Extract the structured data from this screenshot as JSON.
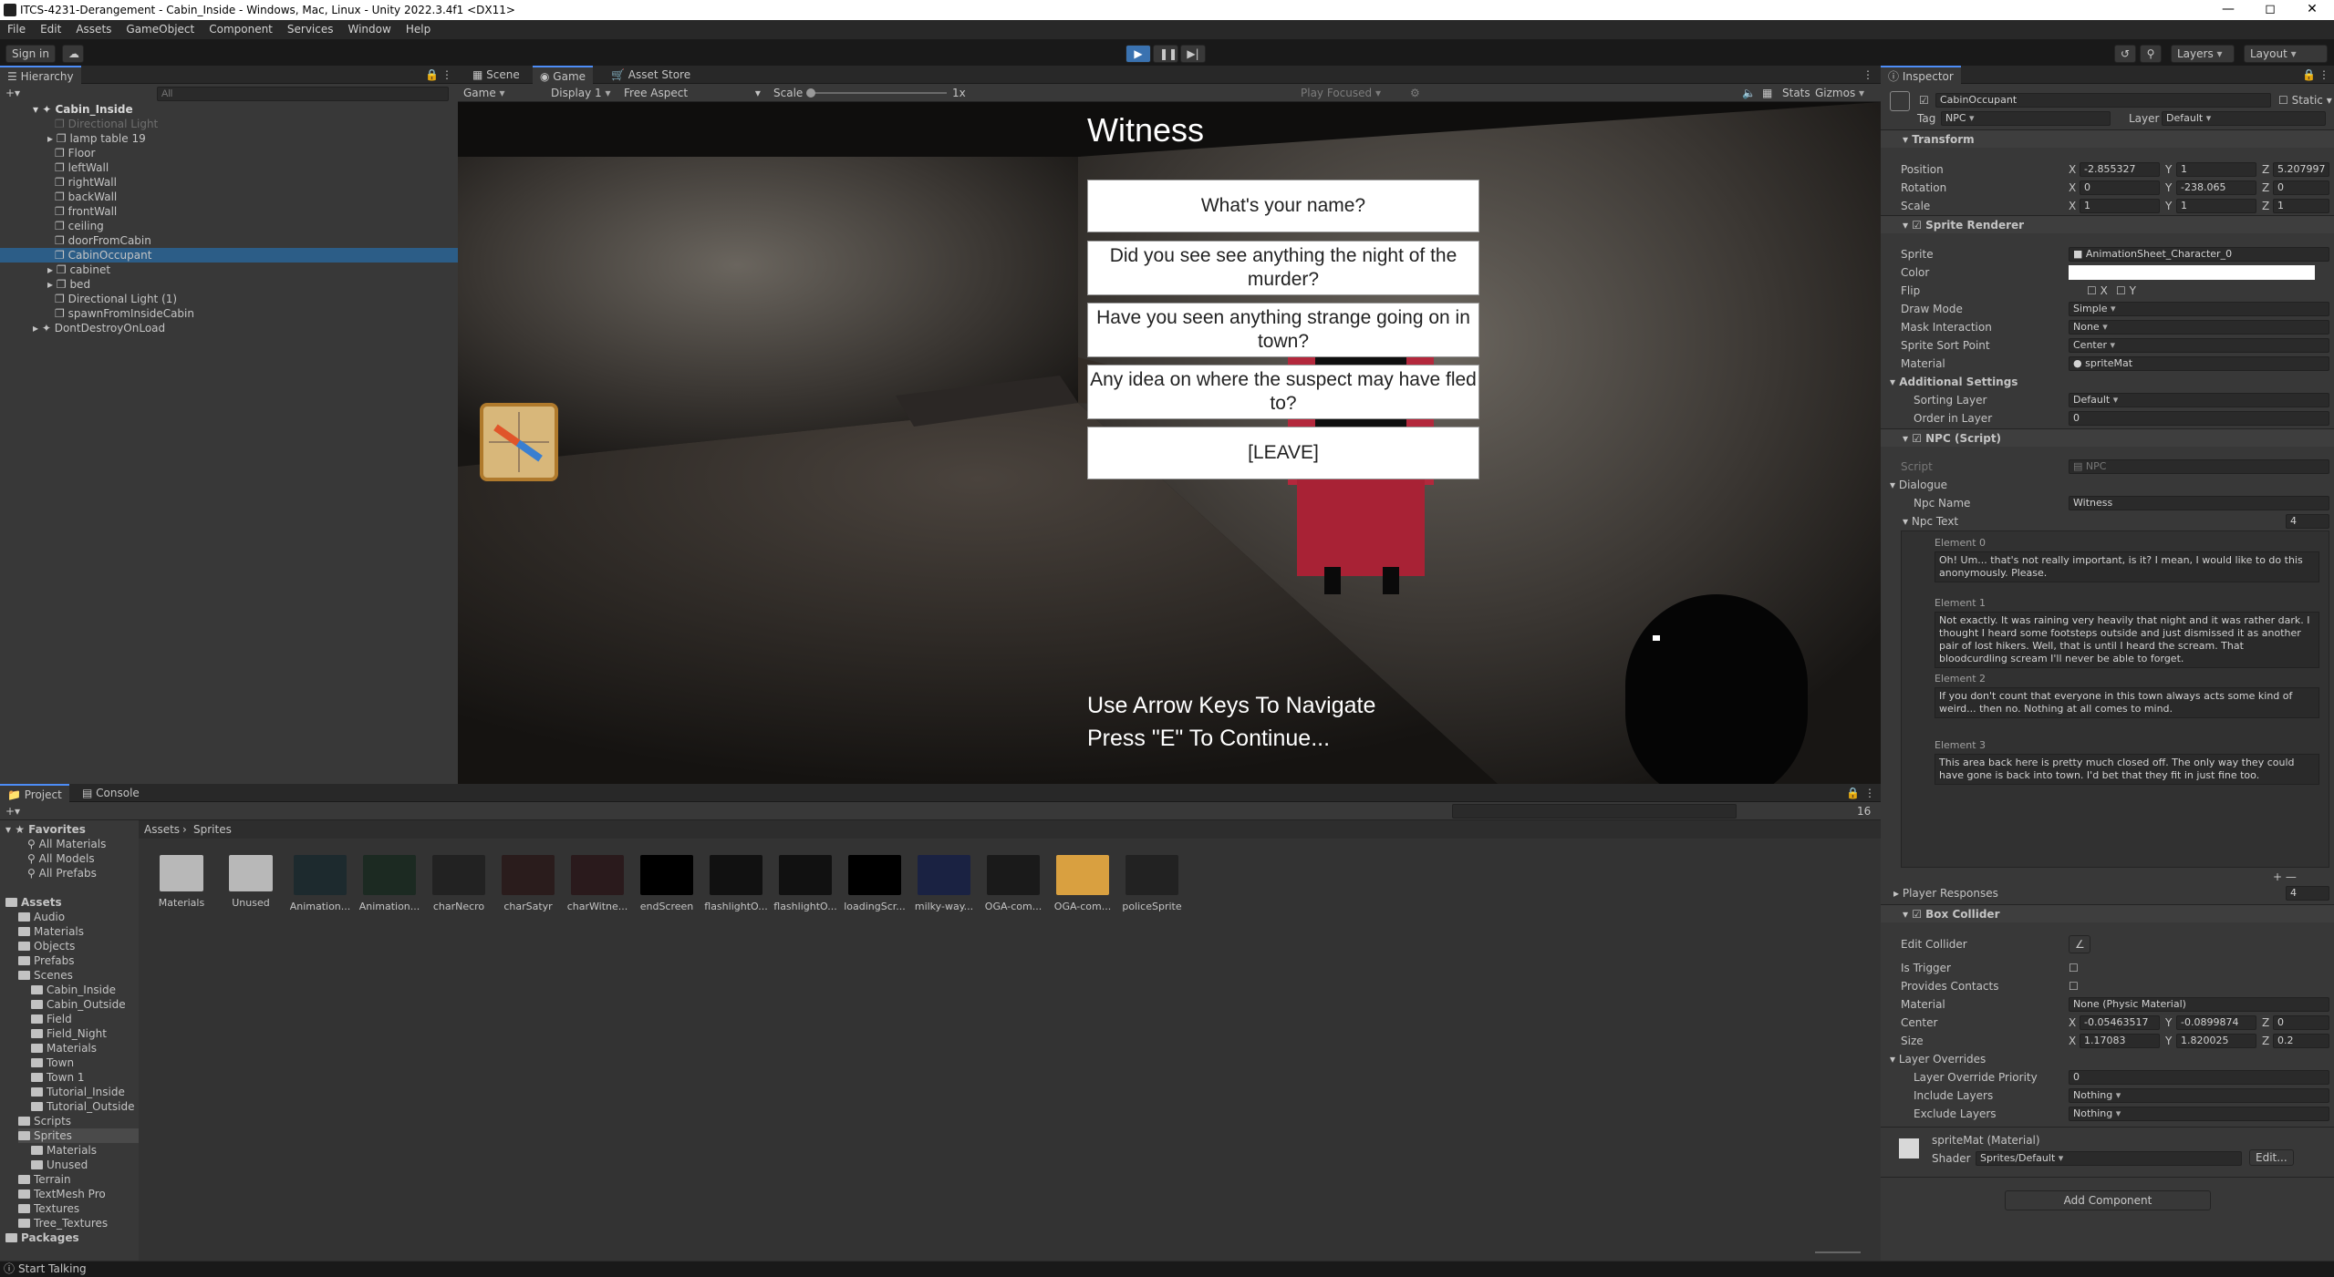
{
  "window": {
    "title": "ITCS-4231-Derangement - Cabin_Inside - Windows, Mac, Linux - Unity 2022.3.4f1 <DX11>"
  },
  "menu": [
    "File",
    "Edit",
    "Assets",
    "GameObject",
    "Component",
    "Services",
    "Window",
    "Help"
  ],
  "toolbar": {
    "sign_in": "Sign in",
    "layers": "Layers",
    "layout": "Layout"
  },
  "hierarchy": {
    "tab": "Hierarchy",
    "search_placeholder": "All",
    "scene": "Cabin_Inside",
    "items": [
      "Directional Light",
      "lamp table 19",
      "Floor",
      "leftWall",
      "rightWall",
      "backWall",
      "frontWall",
      "ceiling",
      "doorFromCabin",
      "CabinOccupant",
      "cabinet",
      "bed",
      "Directional Light (1)",
      "spawnFromInsideCabin"
    ],
    "dont_destroy": "DontDestroyOnLoad"
  },
  "game_view": {
    "tabs": [
      "Scene",
      "Game",
      "Asset Store"
    ],
    "display_mode": "Game",
    "display": "Display 1",
    "aspect": "Free Aspect",
    "scale_label": "Scale",
    "scale_value": "1x",
    "play_focused": "Play Focused",
    "stats": "Stats",
    "gizmos": "Gizmos"
  },
  "dialogue": {
    "npc_title": "Witness",
    "options": [
      "What's your name?",
      "Did you see see anything the night of the murder?",
      "Have you seen anything strange going on in town?",
      "Any idea on where the suspect may have fled to?",
      "[LEAVE]"
    ],
    "hint_line1": "Use Arrow Keys To Navigate",
    "hint_line2": "Press \"E\" To Continue..."
  },
  "project": {
    "tabs": [
      "Project",
      "Console"
    ],
    "breadcrumb": [
      "Assets",
      "Sprites"
    ],
    "favorites_label": "Favorites",
    "favorites": [
      "All Materials",
      "All Models",
      "All Prefabs"
    ],
    "tree": [
      {
        "label": "Assets",
        "depth": 0,
        "bold": true
      },
      {
        "label": "Audio",
        "depth": 1
      },
      {
        "label": "Materials",
        "depth": 1
      },
      {
        "label": "Objects",
        "depth": 1
      },
      {
        "label": "Prefabs",
        "depth": 1
      },
      {
        "label": "Scenes",
        "depth": 1
      },
      {
        "label": "Cabin_Inside",
        "depth": 2
      },
      {
        "label": "Cabin_Outside",
        "depth": 2
      },
      {
        "label": "Field",
        "depth": 2
      },
      {
        "label": "Field_Night",
        "depth": 2
      },
      {
        "label": "Materials",
        "depth": 2
      },
      {
        "label": "Town",
        "depth": 2
      },
      {
        "label": "Town 1",
        "depth": 2
      },
      {
        "label": "Tutorial_Inside",
        "depth": 2
      },
      {
        "label": "Tutorial_Outside",
        "depth": 2
      },
      {
        "label": "Scripts",
        "depth": 1
      },
      {
        "label": "Sprites",
        "depth": 1
      },
      {
        "label": "Materials",
        "depth": 2
      },
      {
        "label": "Unused",
        "depth": 2
      },
      {
        "label": "Terrain",
        "depth": 1
      },
      {
        "label": "TextMesh Pro",
        "depth": 1
      },
      {
        "label": "Textures",
        "depth": 1
      },
      {
        "label": "Tree_Textures",
        "depth": 1
      },
      {
        "label": "Packages",
        "depth": 0,
        "bold": true
      }
    ],
    "assets": [
      "Materials",
      "Unused",
      "Animation...",
      "Animation...",
      "charNecro",
      "charSatyr",
      "charWitne...",
      "endScreen",
      "flashlightO...",
      "flashlightO...",
      "loadingScr...",
      "milky-way...",
      "OGA-com...",
      "OGA-com...",
      "policeSprite"
    ],
    "count": "16"
  },
  "inspector": {
    "tab": "Inspector",
    "object_name": "CabinOccupant",
    "static_label": "Static",
    "tag_label": "Tag",
    "tag_value": "NPC",
    "layer_label": "Layer",
    "layer_value": "Default",
    "transform": {
      "title": "Transform",
      "position": {
        "label": "Position",
        "x": "-2.855327",
        "y": "1",
        "z": "5.207997"
      },
      "rotation": {
        "label": "Rotation",
        "x": "0",
        "y": "-238.065",
        "z": "0"
      },
      "scale": {
        "label": "Scale",
        "x": "1",
        "y": "1",
        "z": "1"
      }
    },
    "sprite_renderer": {
      "title": "Sprite Renderer",
      "sprite_label": "Sprite",
      "sprite_value": "AnimationSheet_Character_0",
      "color_label": "Color",
      "flip_label": "Flip",
      "flip_x": "X",
      "flip_y": "Y",
      "draw_mode_label": "Draw Mode",
      "draw_mode_value": "Simple",
      "mask_label": "Mask Interaction",
      "mask_value": "None",
      "sort_point_label": "Sprite Sort Point",
      "sort_point_value": "Center",
      "material_label": "Material",
      "material_value": "spriteMat",
      "additional_label": "Additional Settings",
      "sorting_layer_label": "Sorting Layer",
      "sorting_layer_value": "Default",
      "order_label": "Order in Layer",
      "order_value": "0"
    },
    "npc_script": {
      "title": "NPC (Script)",
      "script_label": "Script",
      "script_value": "NPC",
      "dialogue_label": "Dialogue",
      "npc_name_label": "Npc Name",
      "npc_name_value": "Witness",
      "npc_text_label": "Npc Text",
      "npc_text_count": "4",
      "elements": [
        {
          "label": "Element 0",
          "text": "Oh! Um... that's not really important, is it? I mean, I would like to do this anonymously. Please."
        },
        {
          "label": "Element 1",
          "text": "Not exactly. It was raining very heavily that night and it was rather dark. I thought I heard some footsteps outside and just dismissed it as another pair of lost hikers. Well, that is until I heard the scream. That bloodcurdling scream I'll never be able to forget."
        },
        {
          "label": "Element 2",
          "text": "If you don't count that everyone in this town always acts some kind of weird... then no. Nothing at all comes to mind."
        },
        {
          "label": "Element 3",
          "text": "This area back here is pretty much closed off. The only way they could have gone is back into town. I'd bet that they fit in just fine too."
        }
      ],
      "player_responses_label": "Player Responses",
      "player_responses_count": "4"
    },
    "box_collider": {
      "title": "Box Collider",
      "edit_label": "Edit Collider",
      "trigger_label": "Is Trigger",
      "contacts_label": "Provides Contacts",
      "material_label": "Material",
      "material_value": "None (Physic Material)",
      "center": {
        "label": "Center",
        "x": "-0.05463517",
        "y": "-0.0899874",
        "z": "0"
      },
      "size": {
        "label": "Size",
        "x": "1.17083",
        "y": "1.820025",
        "z": "0.2"
      },
      "overrides_label": "Layer Overrides",
      "priority_label": "Layer Override Priority",
      "priority_value": "0",
      "include_label": "Include Layers",
      "include_value": "Nothing",
      "exclude_label": "Exclude Layers",
      "exclude_value": "Nothing"
    },
    "material": {
      "title": "spriteMat (Material)",
      "shader_label": "Shader",
      "shader_value": "Sprites/Default",
      "edit": "Edit..."
    },
    "add_component": "Add Component"
  },
  "status": {
    "text": "Start Talking"
  },
  "colors": {
    "accent": "#4d8df7",
    "selection": "#2c5d87",
    "npc_red": "#b3283c",
    "panel": "#383838"
  }
}
